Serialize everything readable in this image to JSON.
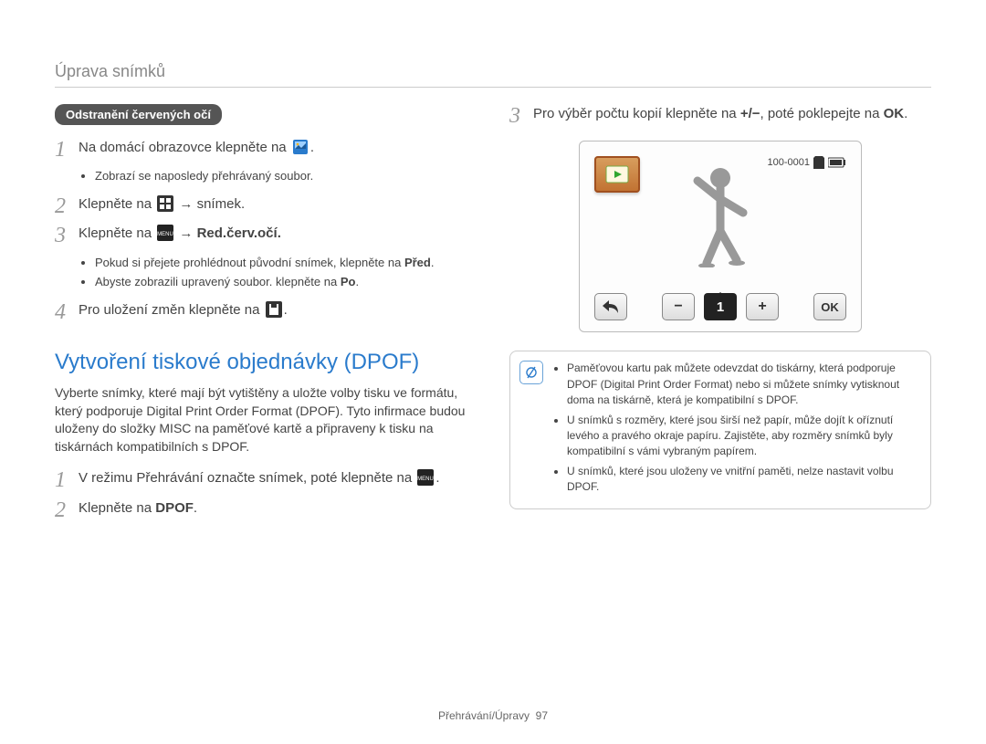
{
  "header": "Úprava snímků",
  "left": {
    "pill": "Odstranění červených očí",
    "steps": [
      {
        "num": "1",
        "text": "Na domácí obrazovce klepněte na "
      },
      {
        "num": "2",
        "text_pre": "Klepněte na ",
        "text_post": " snímek."
      },
      {
        "num": "3",
        "text_pre": "Klepněte na ",
        "text_post": " Red.červ.očí."
      },
      {
        "num": "4",
        "text_pre": "Pro uložení změn klepněte na "
      }
    ],
    "sub1": "Zobrazí se naposledy přehrávaný soubor.",
    "sub3a_pre": "Pokud si přejete prohlédnout původní snímek, klepněte na ",
    "sub3a_bold": "Před",
    "sub3b_pre": "Abyste zobrazili upravený soubor. klepněte na ",
    "sub3b_bold": "Po",
    "section_title": "Vytvoření tiskové objednávky (DPOF)",
    "para": "Vyberte snímky, které mají být vytištěny a uložte volby tisku ve formátu, který podporuje Digital Print Order Format (DPOF). Tyto infirmace budou uloženy do složky MISC na paměťové kartě a připraveny k tisku na tiskárnách kompatibilních s DPOF.",
    "dpof_steps": [
      {
        "num": "1",
        "text_pre": "V režimu Přehrávání označte snímek, poté klepněte na "
      },
      {
        "num": "2",
        "text_pre": "Klepněte na ",
        "bold": "DPOF"
      }
    ]
  },
  "right": {
    "step3_pre": "Pro výběr počtu kopií klepněte na ",
    "step3_mid": ", poté poklepejte na ",
    "step3_num": "3",
    "lcd": {
      "file_no": "100-0001",
      "count": "1",
      "ok": "OK"
    },
    "notes": [
      "Paměťovou kartu pak můžete odevzdat do tiskárny, která podporuje DPOF (Digital Print Order Format) nebo si můžete snímky vytisknout doma na tiskárně, která je kompatibilní s DPOF.",
      "U snímků s rozměry, které jsou širší než papír, může dojít k oříznutí levého a pravého okraje papíru. Zajistěte, aby rozměry snímků byly kompatibilní s vámi vybraným papírem.",
      "U snímků, které jsou uloženy ve vnitřní paměti, nelze nastavit volbu DPOF."
    ]
  },
  "footer": {
    "label": "Přehrávání/Úpravy",
    "page": "97"
  },
  "icons": {
    "arrow": "→",
    "plus_minus": "+/−",
    "ok_text": "OK"
  }
}
